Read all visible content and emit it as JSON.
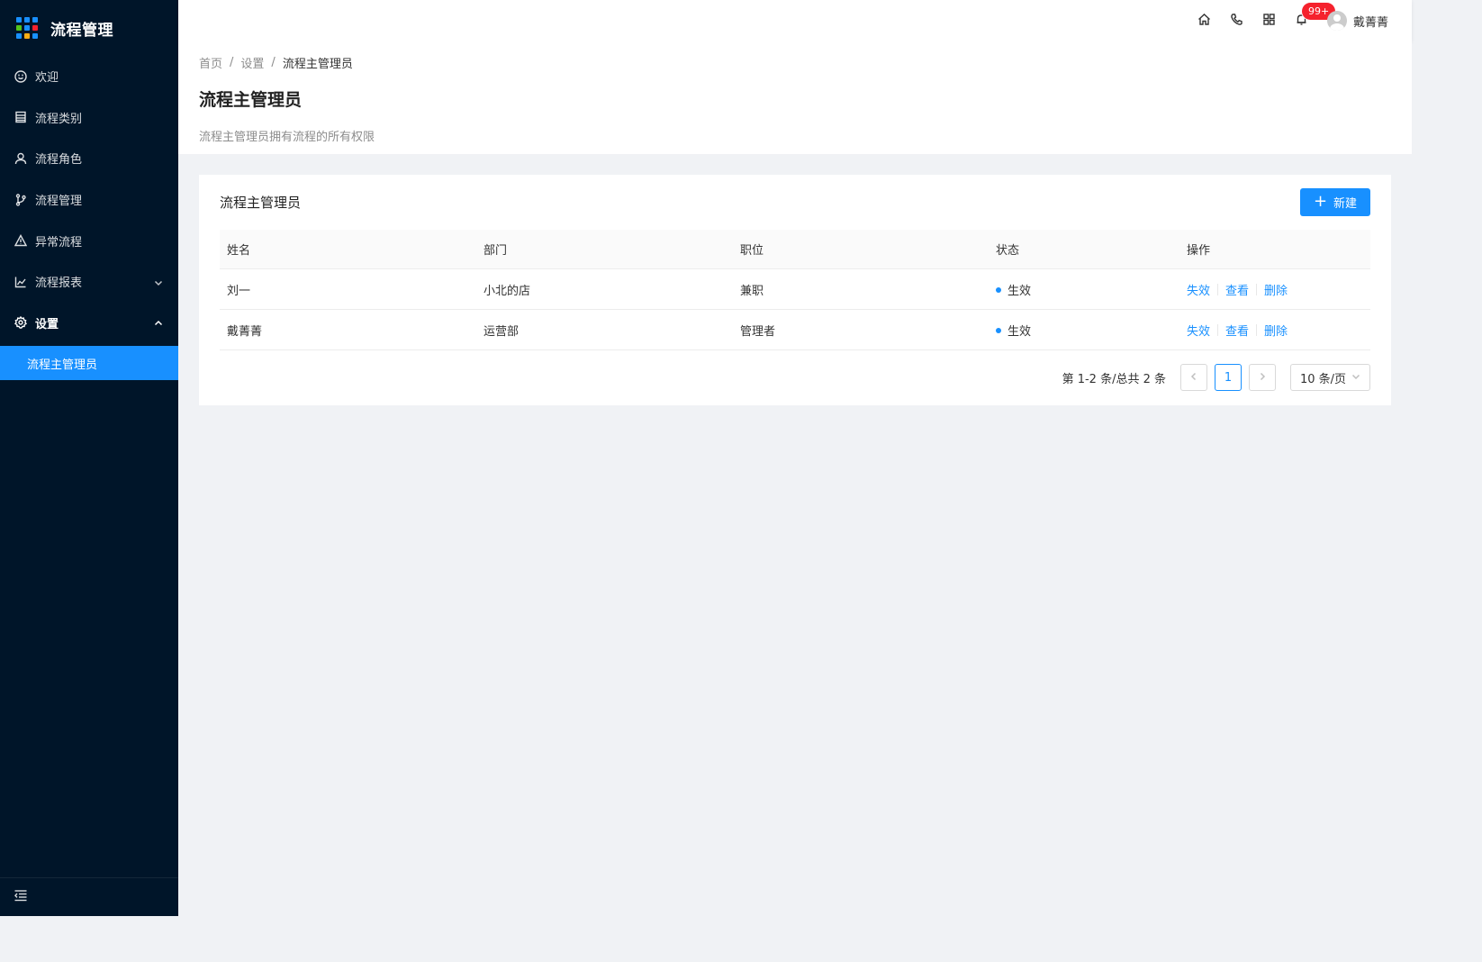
{
  "app": {
    "title": "流程管理",
    "logo_colors": [
      "#1890ff",
      "#1890ff",
      "#1890ff",
      "#52c41a",
      "#1890ff",
      "#f5222d",
      "#1890ff",
      "#faad14",
      "#1890ff"
    ]
  },
  "sidebar": {
    "items": [
      {
        "label": "欢迎",
        "icon": "smile-icon"
      },
      {
        "label": "流程类别",
        "icon": "table-icon"
      },
      {
        "label": "流程角色",
        "icon": "user-icon"
      },
      {
        "label": "流程管理",
        "icon": "branch-icon"
      },
      {
        "label": "异常流程",
        "icon": "warning-icon"
      },
      {
        "label": "流程报表",
        "icon": "chart-icon",
        "expanded": false
      },
      {
        "label": "设置",
        "icon": "setting-icon",
        "expanded": true
      }
    ],
    "submenu": [
      {
        "label": "流程主管理员",
        "active": true
      }
    ],
    "footer_icon": "menu-fold-icon"
  },
  "header": {
    "icons": [
      "home-icon",
      "phone-icon",
      "appstore-icon",
      "bell-icon"
    ],
    "notification_badge": "99+",
    "user_name": "戴菁菁"
  },
  "breadcrumb": {
    "items": [
      "首页",
      "设置",
      "流程主管理员"
    ]
  },
  "page": {
    "title": "流程主管理员",
    "description": "流程主管理员拥有流程的所有权限"
  },
  "card": {
    "title": "流程主管理员",
    "new_button": "新建"
  },
  "table": {
    "columns": [
      "姓名",
      "部门",
      "职位",
      "状态",
      "操作"
    ],
    "rows": [
      {
        "name": "刘一",
        "department": "小北的店",
        "position": "兼职",
        "status": "生效",
        "actions": [
          "失效",
          "查看",
          "删除"
        ]
      },
      {
        "name": "戴菁菁",
        "department": "运营部",
        "position": "管理者",
        "status": "生效",
        "actions": [
          "失效",
          "查看",
          "删除"
        ]
      }
    ]
  },
  "pagination": {
    "total_text": "第 1-2 条/总共 2 条",
    "current_page": "1",
    "page_size": "10 条/页"
  },
  "colors": {
    "sidebar_bg": "#001529",
    "primary": "#1890ff",
    "badge": "#f5222d"
  }
}
